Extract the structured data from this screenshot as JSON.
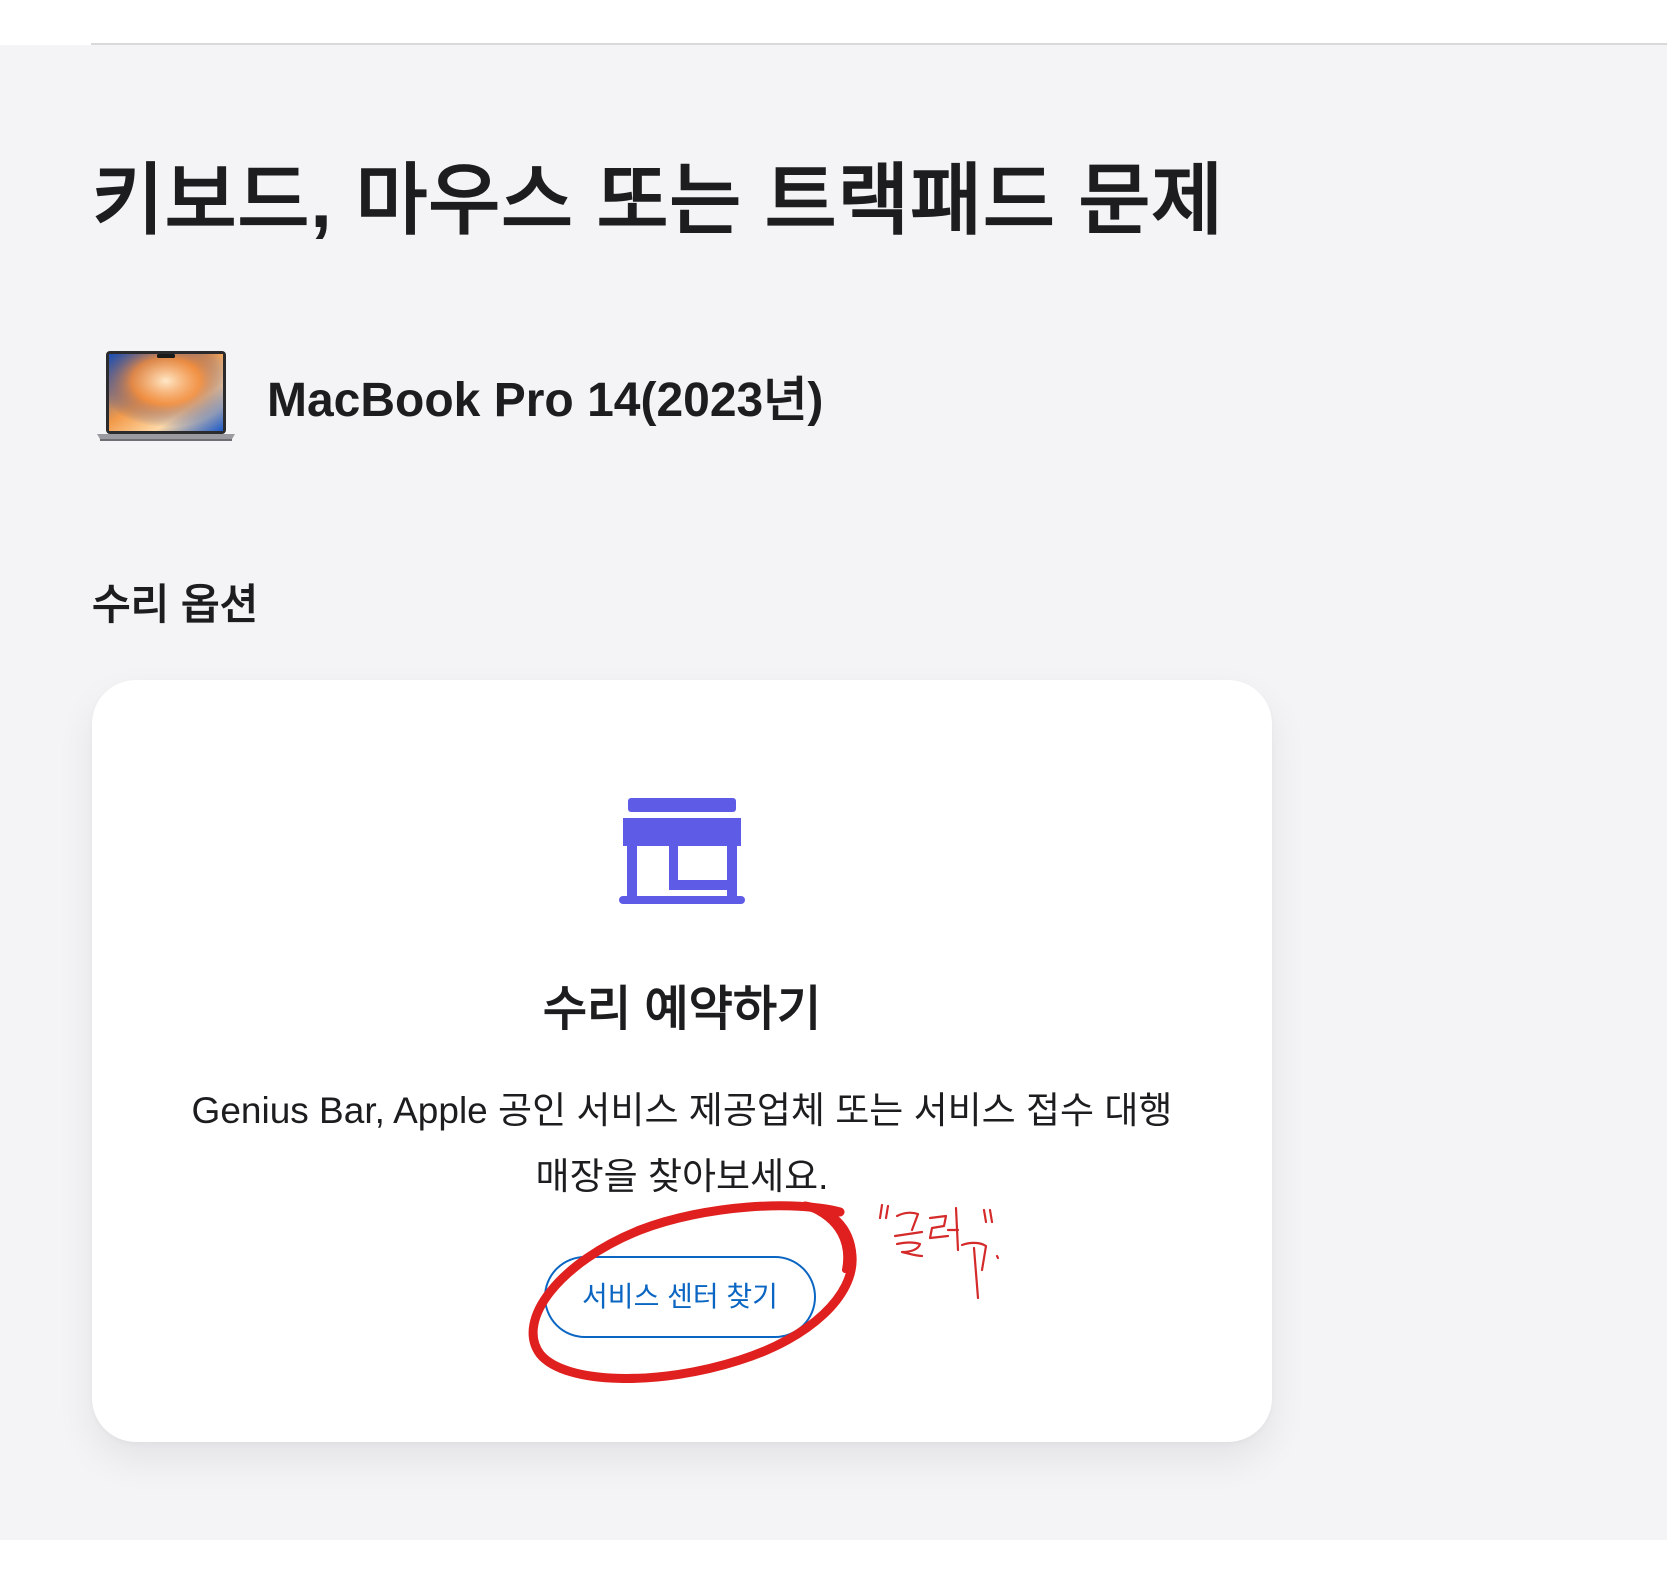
{
  "page": {
    "title": "키보드, 마우스 또는 트랙패드 문제"
  },
  "device": {
    "name": "MacBook Pro 14(2023년)",
    "image_icon": "macbook-pro-image"
  },
  "repair_options": {
    "heading": "수리 옵션",
    "card": {
      "icon": "storefront-icon",
      "title": "수리 예약하기",
      "description": "Genius Bar, Apple 공인 서비스 제공업체 또는 서비스 접수 대행 매장을 찾아보세요.",
      "button_label": "서비스 센터 찾기"
    }
  },
  "annotation": {
    "handwritten_note": "\"클릭\"",
    "color": "#e0201e"
  },
  "colors": {
    "accent": "#0a66c2",
    "icon": "#5e5ce6",
    "background": "#f4f4f6",
    "card": "#ffffff",
    "text": "#1d1d1f"
  }
}
